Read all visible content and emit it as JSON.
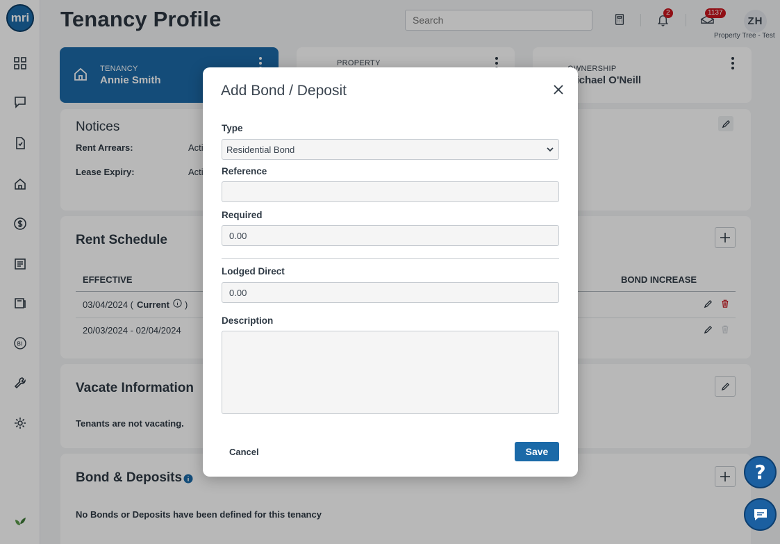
{
  "app": {
    "logo_text": "mri",
    "page_title": "Tenancy Profile",
    "search": {
      "placeholder": "Search"
    },
    "notifications_count": "2",
    "messages_count": "1137",
    "user_initials": "ZH",
    "org_name": "Property Tree - Test"
  },
  "sidebar": {
    "icons": [
      "dashboard-icon",
      "chat-icon",
      "document-icon",
      "home-icon",
      "dollar-icon",
      "ledger-icon",
      "inbox-icon",
      "bi-icon",
      "wrench-icon",
      "settings-icon",
      "leaf-icon"
    ]
  },
  "cards": {
    "tenancy": {
      "label": "TENANCY",
      "value": "Annie Smith"
    },
    "property": {
      "label": "PROPERTY"
    },
    "ownership": {
      "label": "OWNERSHIP",
      "value": "Michael O'Neill"
    }
  },
  "notices": {
    "title": "Notices",
    "rows": [
      {
        "label": "Rent Arrears:",
        "value": "Acti"
      },
      {
        "label": "Lease Expiry:",
        "value": "Acti"
      }
    ]
  },
  "rent_schedule": {
    "title": "Rent Schedule",
    "columns": {
      "effective": "EFFECTIVE",
      "bond_increase": "BOND INCREASE"
    },
    "rows": [
      {
        "effective": "03/04/2024 (",
        "current": "Current",
        "close": ")"
      },
      {
        "effective": "20/03/2024 - 02/04/2024"
      }
    ]
  },
  "vacate": {
    "title": "Vacate Information",
    "text": "Tenants are not vacating."
  },
  "bonds": {
    "title": "Bond & Deposits",
    "text": "No Bonds or Deposits have been defined for this tenancy"
  },
  "modal": {
    "title": "Add Bond / Deposit",
    "type_label": "Type",
    "type_value": "Residential Bond",
    "reference_label": "Reference",
    "reference_value": "",
    "required_label": "Required",
    "required_value": "0.00",
    "lodged_label": "Lodged Direct",
    "lodged_value": "0.00",
    "description_label": "Description",
    "cancel_label": "Cancel",
    "save_label": "Save"
  },
  "colors": {
    "brand": "#1b6aa8",
    "danger": "#c8161e"
  }
}
